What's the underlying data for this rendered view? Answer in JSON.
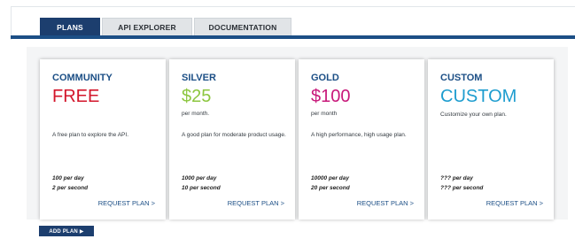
{
  "tabs": [
    {
      "label": "PLANS"
    },
    {
      "label": "API EXPLORER"
    },
    {
      "label": "DOCUMENTATION"
    }
  ],
  "plans": [
    {
      "name": "COMMUNITY",
      "price": "FREE",
      "price_color": "#d3162b",
      "period": "",
      "description": "A free plan to explore the API.",
      "per_day": "100 per day",
      "per_second": "2 per second",
      "action": "REQUEST PLAN >"
    },
    {
      "name": "SILVER",
      "price": "$25",
      "price_color": "#8cc63f",
      "period": "per month.",
      "description": "A good plan for moderate product usage.",
      "per_day": "1000 per day",
      "per_second": "10 per second",
      "action": "REQUEST PLAN >"
    },
    {
      "name": "GOLD",
      "price": "$100",
      "price_color": "#c8187a",
      "period": "per month",
      "description": "A high performance, high usage plan.",
      "per_day": "10000 per day",
      "per_second": "20 per second",
      "action": "REQUEST PLAN >"
    },
    {
      "name": "CUSTOM",
      "price": "CUSTOM",
      "price_color": "#1e9dcf",
      "period": "",
      "description": "Customize your own plan.",
      "per_day": "??? per day",
      "per_second": "??? per second",
      "action": "REQUEST PLAN >"
    }
  ],
  "add_plan": {
    "label": "ADD PLAN ▶"
  },
  "colors": {
    "nav": "#1c4f86",
    "active_tab": "#1c3e6e",
    "link": "#1c4f86"
  }
}
